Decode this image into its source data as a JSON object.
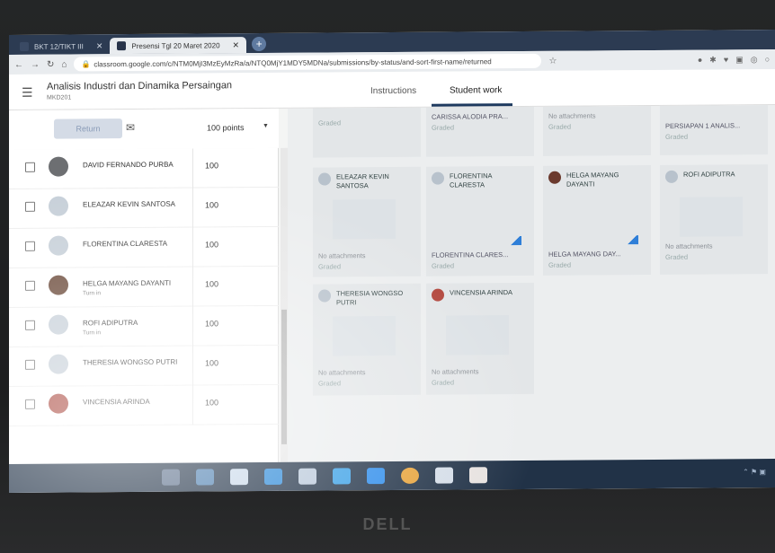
{
  "browser": {
    "tabs": [
      {
        "label": "BKT 12/TIKT III",
        "active": false
      },
      {
        "label": "Presensi Tgl 20 Maret 2020",
        "active": true
      }
    ],
    "url": "classroom.google.com/c/NTM0MjI3MzEyMzRa/a/NTQ0MjY1MDY5MDNa/submissions/by-status/and-sort-first-name/returned"
  },
  "header": {
    "course_title": "Analisis Industri dan Dinamika Persaingan",
    "course_code": "MKD201",
    "tabs": [
      "Instructions",
      "Student work"
    ]
  },
  "toolbar": {
    "return_label": "Return",
    "points_label": "100 points"
  },
  "students": [
    {
      "name": "DAVID FERNANDO PURBA",
      "status": "",
      "grade": "100"
    },
    {
      "name": "ELEAZAR KEVIN SANTOSA",
      "status": "",
      "grade": "100"
    },
    {
      "name": "FLORENTINA CLARESTA",
      "status": "",
      "grade": "100"
    },
    {
      "name": "HELGA MAYANG DAYANTI",
      "status": "Turn in",
      "grade": "100"
    },
    {
      "name": "ROFI ADIPUTRA",
      "status": "Turn in",
      "grade": "100"
    },
    {
      "name": "THERESIA WONGSO PUTRI",
      "status": "",
      "grade": "100"
    },
    {
      "name": "VINCENSIA ARINDA",
      "status": "",
      "grade": "100"
    }
  ],
  "top_cards": [
    {
      "name": "",
      "attachment": "",
      "status": "Graded"
    },
    {
      "name": "CARISSA ALODIA PRA...",
      "attachment": "",
      "status": "Graded"
    },
    {
      "name": "No attachments",
      "attachment": "",
      "status": "Graded"
    },
    {
      "name": "PERSIAPAN 1 ANALIS...",
      "attachment": "",
      "status": "Graded"
    }
  ],
  "cards": [
    {
      "name": "ELEAZAR KEVIN SANTOSA",
      "attachment": "No attachments",
      "status": "Graded"
    },
    {
      "name": "FLORENTINA CLARESTA",
      "attachment": "FLORENTINA CLARES...",
      "status": "Graded"
    },
    {
      "name": "HELGA MAYANG DAYANTI",
      "attachment": "HELGA MAYANG DAY...",
      "status": "Graded"
    },
    {
      "name": "ROFI ADIPUTRA",
      "attachment": "No attachments",
      "status": "Graded"
    },
    {
      "name": "THERESIA WONGSO PUTRI",
      "attachment": "No attachments",
      "status": "Graded"
    },
    {
      "name": "VINCENSIA ARINDA",
      "attachment": "No attachments",
      "status": "Graded"
    }
  ],
  "laptop_brand": "DELL"
}
